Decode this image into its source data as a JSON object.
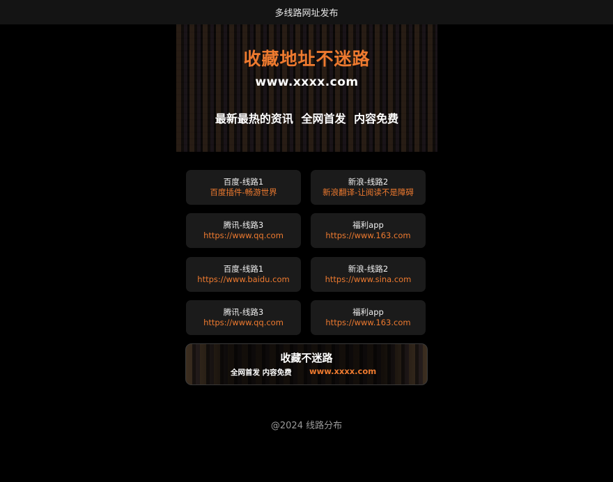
{
  "header": {
    "title": "多线路网址发布"
  },
  "banner": {
    "title": "收藏地址不迷路",
    "url": "www.xxxx.com",
    "slogan": "最新最热的资讯 全网首发 内容免费"
  },
  "lines": [
    {
      "title": "百度-线路1",
      "subtitle": "百度插件-畅游世界"
    },
    {
      "title": "新浪-线路2",
      "subtitle": "新浪翻译-让阅读不是障碍"
    },
    {
      "title": "腾讯-线路3",
      "subtitle": "https://www.qq.com"
    },
    {
      "title": "福利app",
      "subtitle": "https://www.163.com"
    },
    {
      "title": "百度-线路1",
      "subtitle": "https://www.baidu.com"
    },
    {
      "title": "新浪-线路2",
      "subtitle": "https://www.sina.com"
    },
    {
      "title": "腾讯-线路3",
      "subtitle": "https://www.qq.com"
    },
    {
      "title": "福利app",
      "subtitle": "https://www.163.com"
    }
  ],
  "promo": {
    "title": "收藏不迷路",
    "slogan": "全网首发 内容免费",
    "url": "www.xxxx.com"
  },
  "footer": {
    "text": "@2024 线路分布"
  },
  "colors": {
    "accent": "#ee7a2f",
    "background": "#000000",
    "card": "#1b1b1b",
    "header": "#141414"
  }
}
